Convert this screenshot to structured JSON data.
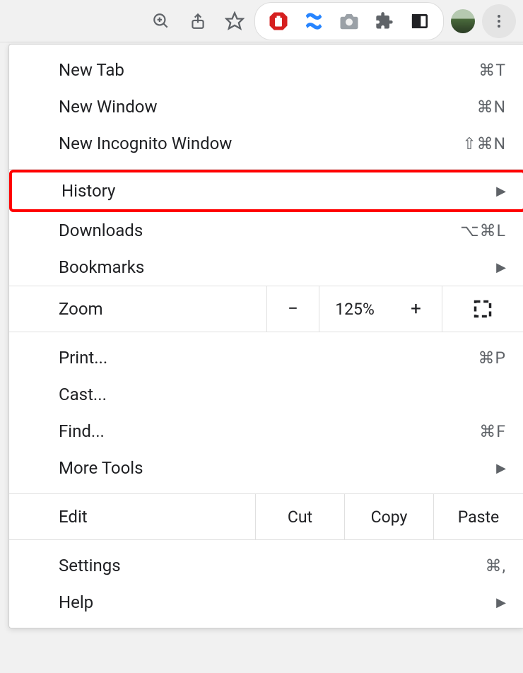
{
  "toolbar": {
    "zoom_page_icon": "zoom",
    "share_icon": "share",
    "bookmark_icon": "star",
    "extensions": [
      "ublock",
      "confluence",
      "camera",
      "puzzle",
      "panel"
    ]
  },
  "menu": {
    "new_tab": {
      "label": "New Tab",
      "shortcut": "⌘T"
    },
    "new_window": {
      "label": "New Window",
      "shortcut": "⌘N"
    },
    "new_incognito": {
      "label": "New Incognito Window",
      "shortcut": "⇧⌘N"
    },
    "history": {
      "label": "History"
    },
    "downloads": {
      "label": "Downloads",
      "shortcut": "⌥⌘L"
    },
    "bookmarks": {
      "label": "Bookmarks"
    },
    "zoom": {
      "label": "Zoom",
      "minus": "−",
      "value": "125%",
      "plus": "+"
    },
    "print": {
      "label": "Print...",
      "shortcut": "⌘P"
    },
    "cast": {
      "label": "Cast..."
    },
    "find": {
      "label": "Find...",
      "shortcut": "⌘F"
    },
    "more_tools": {
      "label": "More Tools"
    },
    "edit": {
      "label": "Edit",
      "cut": "Cut",
      "copy": "Copy",
      "paste": "Paste"
    },
    "settings": {
      "label": "Settings",
      "shortcut": "⌘,"
    },
    "help": {
      "label": "Help"
    }
  }
}
